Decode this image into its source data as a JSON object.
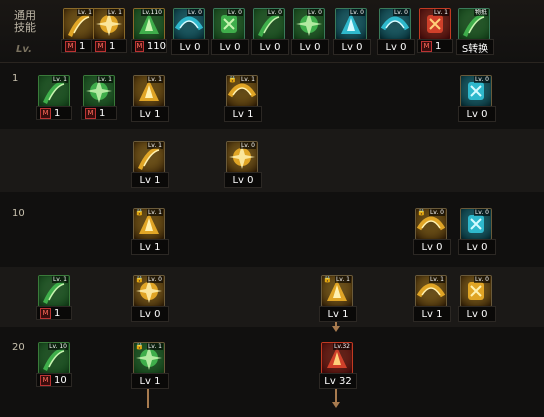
{
  "common": {
    "label_line1": "通用",
    "label_line2": "技能",
    "lv_label": "Lv.",
    "slots": [
      {
        "mini": "Lv. 1",
        "cap": "1",
        "m": "M",
        "icon": "fire-slash-icon"
      },
      {
        "mini": "Lv. 1",
        "cap": "1",
        "m": "M",
        "icon": "grab-icon"
      },
      {
        "mini": "Lv.110",
        "cap": "110",
        "m": "M",
        "icon": "sprint-icon"
      },
      {
        "mini": "Lv. 0",
        "cap": "Lv 0",
        "m": "",
        "icon": "wing-icon"
      },
      {
        "mini": "Lv. 0",
        "cap": "Lv 0",
        "m": "",
        "icon": "leap-icon"
      },
      {
        "mini": "Lv. 0",
        "cap": "Lv 0",
        "m": "",
        "icon": "crosshair-icon"
      },
      {
        "mini": "Lv. 0",
        "cap": "Lv 0",
        "m": "",
        "icon": "dash-icon"
      },
      {
        "mini": "Lv. 0",
        "cap": "Lv 0",
        "m": "",
        "icon": "eye-icon"
      },
      {
        "mini": "Lv. 0",
        "cap": "Lv 0",
        "m": "",
        "icon": "body-icon"
      },
      {
        "mini": "Lv. 1",
        "cap": "1",
        "m": "M",
        "icon": "explosion-icon"
      },
      {
        "mini": "物抵",
        "cap": "S转换",
        "m": "",
        "icon": "convert-icon"
      }
    ]
  },
  "rows": {
    "r1": "1",
    "r10": "10",
    "r20": "20"
  },
  "tree": [
    {
      "id": "a1",
      "mini": "Lv. 1",
      "cap": "1",
      "m": "M",
      "lock": "",
      "icon": "green-weapon-icon"
    },
    {
      "id": "a2",
      "mini": "Lv. 1",
      "cap": "1",
      "m": "M",
      "lock": "",
      "icon": "green-shield-icon"
    },
    {
      "id": "a3",
      "mini": "Lv. 1",
      "cap": "Lv 1",
      "m": "",
      "lock": "",
      "icon": "golden-slash-icon"
    },
    {
      "id": "a4",
      "mini": "Lv. 1",
      "cap": "Lv 1",
      "m": "",
      "lock": "🔒",
      "icon": "golden-arc-icon"
    },
    {
      "id": "a5",
      "mini": "Lv. 0",
      "cap": "Lv 0",
      "m": "",
      "lock": "",
      "icon": "water-fist-icon"
    },
    {
      "id": "b1",
      "mini": "Lv. 1",
      "cap": "Lv 1",
      "m": "",
      "lock": "",
      "icon": "burst-kick-icon"
    },
    {
      "id": "b2",
      "mini": "Lv. 0",
      "cap": "Lv 0",
      "m": "",
      "lock": "",
      "icon": "burst-spin-icon"
    },
    {
      "id": "c1",
      "mini": "Lv. 1",
      "cap": "Lv 1",
      "m": "",
      "lock": "🔒",
      "icon": "lightning-strike-icon"
    },
    {
      "id": "c2",
      "mini": "Lv. 0",
      "cap": "Lv 0",
      "m": "",
      "lock": "🔒",
      "icon": "golden-warrior-icon"
    },
    {
      "id": "c3",
      "mini": "Lv. 0",
      "cap": "Lv 0",
      "m": "",
      "lock": "",
      "icon": "cyan-sword-icon"
    },
    {
      "id": "d1",
      "mini": "Lv. 1",
      "cap": "1",
      "m": "M",
      "lock": "",
      "icon": "green-scale-icon"
    },
    {
      "id": "d2",
      "mini": "Lv. 0",
      "cap": "Lv 0",
      "m": "",
      "lock": "🔒",
      "icon": "flying-slash-icon"
    },
    {
      "id": "d3",
      "mini": "Lv. 1",
      "cap": "Lv 1",
      "m": "",
      "lock": "🔒",
      "icon": "golden-dive-icon"
    },
    {
      "id": "d4",
      "mini": "Lv. 1",
      "cap": "Lv 1",
      "m": "",
      "lock": "",
      "icon": "golden-crescent-icon"
    },
    {
      "id": "d5",
      "mini": "Lv. 0",
      "cap": "Lv 0",
      "m": "",
      "lock": "",
      "icon": "flame-burst-icon"
    },
    {
      "id": "e1",
      "mini": "Lv. 10",
      "cap": "10",
      "m": "M",
      "lock": "",
      "icon": "green-kick-icon"
    },
    {
      "id": "e2",
      "mini": "Lv. 1",
      "cap": "Lv 1",
      "m": "",
      "lock": "🔒",
      "icon": "golden-wing-slash-icon"
    },
    {
      "id": "e3",
      "mini": "Lv.32",
      "cap": "Lv 32",
      "m": "",
      "lock": "",
      "icon": "red-awakening-icon"
    }
  ],
  "colors": {
    "green": "#2f8f3a",
    "gold": "#d4a02a",
    "cyan": "#34b6c8",
    "red": "#c23a22",
    "arrow": "#a87b4f"
  }
}
